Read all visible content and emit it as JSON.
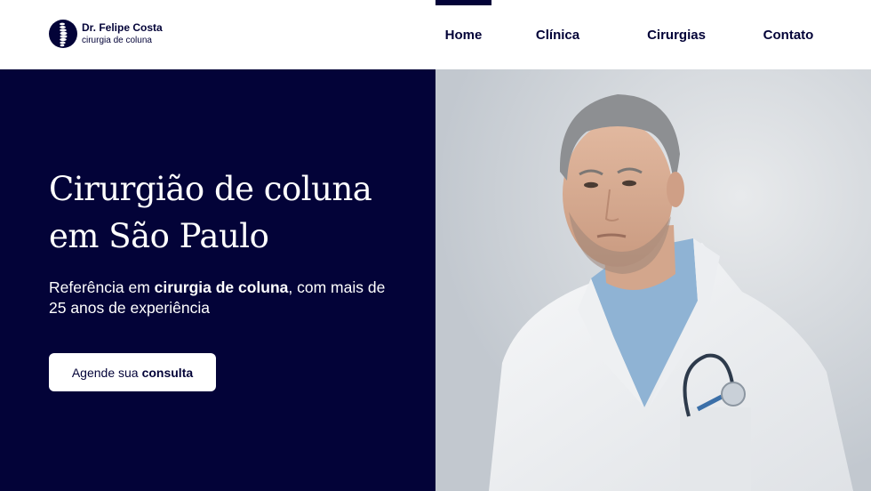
{
  "brand": {
    "name": "Dr. Felipe Costa",
    "tagline": "cirurgia de coluna",
    "logo_icon": "spine-icon",
    "navy": "#030338"
  },
  "nav": {
    "items": [
      {
        "label": "Home",
        "active": true
      },
      {
        "label": "Clínica",
        "active": false
      },
      {
        "label": "Cirurgias",
        "active": false
      },
      {
        "label": "Contato",
        "active": false
      }
    ]
  },
  "hero": {
    "title_line1": "Cirurgião de coluna",
    "title_line2": "em São Paulo",
    "subtitle_pre": "Referência em ",
    "subtitle_bold": "cirurgia de coluna",
    "subtitle_post": ", com mais de 25 anos de experiência",
    "cta_pre": "Agende sua",
    "cta_bold": "consulta",
    "photo": "doctor-portrait"
  }
}
